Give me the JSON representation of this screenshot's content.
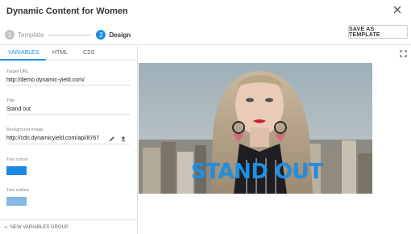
{
  "dialog": {
    "title": "Dynamic Content for Women"
  },
  "steps": [
    {
      "number": "1",
      "label": "Template"
    },
    {
      "number": "2",
      "label": "Design"
    }
  ],
  "header": {
    "save_label": "SAVE AS TEMPLATE"
  },
  "tabs": [
    {
      "label": "VARIABLES"
    },
    {
      "label": "HTML"
    },
    {
      "label": "CSS"
    }
  ],
  "fields": {
    "target_url": {
      "label": "Target URL",
      "value": "http://demo.dynamic-yield.com/"
    },
    "title": {
      "label": "Title",
      "value": "Stand out"
    },
    "background_image": {
      "label": "Background image",
      "value": "http://cdn.dynamicyield.com/api/8767"
    },
    "text_colour": {
      "label": "Text colour",
      "color": "#1e88e5"
    },
    "text_outline": {
      "label": "Text outline",
      "color": "#85b9e3"
    }
  },
  "footer": {
    "new_group_label": "NEW VARIABLES GROUP"
  },
  "preview": {
    "headline": "STAND OUT"
  },
  "colors": {
    "accent": "#1a8fe0"
  }
}
